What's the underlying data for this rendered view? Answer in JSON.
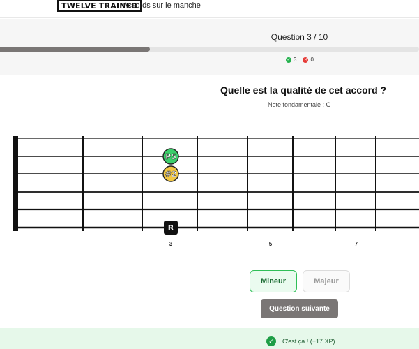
{
  "header": {
    "logo": "TWELVE TRAINER",
    "subtitle": "Accords sur le manche"
  },
  "progress": {
    "label": "Question 3 / 10",
    "fraction": 0.357,
    "correct_count": "3",
    "wrong_count": "0",
    "correct_icon": "check-icon",
    "wrong_icon": "cross-icon"
  },
  "prompt": {
    "question": "Quelle est la qualité de cet accord ?",
    "root_note": "Note fondamentale : G"
  },
  "fretboard": {
    "strings": 6,
    "fret_numbers": [
      "3",
      "5",
      "7"
    ],
    "markers": [
      {
        "label": "P5",
        "string": 2,
        "fret": 3,
        "color": "#3ccf6b"
      },
      {
        "label": "#2",
        "string": 3,
        "fret": 3,
        "color": "#f2c744"
      },
      {
        "label": "R",
        "string": 6,
        "fret": 3,
        "color": "#111111"
      }
    ]
  },
  "answers": {
    "minor": "Mineur",
    "major": "Majeur",
    "next": "Question suivante"
  },
  "feedback": {
    "text": "C'est ça ! (+17 XP)",
    "icon": "check-circle-icon"
  },
  "colors": {
    "accent_green": "#22b14c",
    "error_red": "#e53935",
    "progress_fill": "#7a7675"
  }
}
